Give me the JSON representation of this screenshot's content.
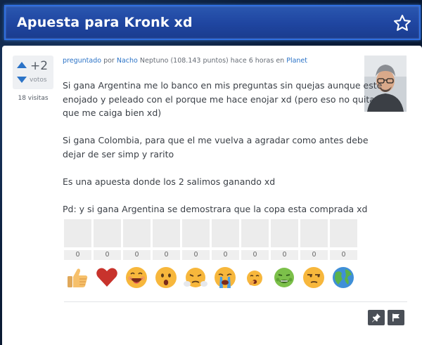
{
  "question": {
    "title": "Apuesta para Kronk xd",
    "votes": {
      "count": "+2",
      "label": "votos"
    },
    "views": "18 visitas",
    "meta": {
      "action": "preguntado",
      "by": "por",
      "user": "Nacho",
      "rank": "Neptuno (108.143 puntos)",
      "time": "hace 6 horas",
      "in": "en",
      "category": "Planet"
    },
    "body": [
      "Si gana Argentina me lo banco en mis preguntas sin quejas aunque este enojado y peleado con el porque me hace enojar xd (pero eso no quita que me caiga bien xd)",
      "Si gana Colombia, para que el me vuelva a agradar como antes debe dejar de ser simp y rarito",
      "Es una apuesta donde los 2 salimos ganando xd",
      "Pd: y si gana Argentina se demostrara que la copa esta comprada xd"
    ]
  },
  "reactions": [
    {
      "icon": "thumbs-up-icon",
      "count": "0",
      "level": 0
    },
    {
      "icon": "heart-icon",
      "count": "0",
      "level": 0
    },
    {
      "icon": "laughing-face-icon",
      "count": "0",
      "level": 0
    },
    {
      "icon": "surprised-face-icon",
      "count": "0",
      "level": 0
    },
    {
      "icon": "steaming-face-icon",
      "count": "0",
      "level": 0
    },
    {
      "icon": "crying-face-icon",
      "count": "0",
      "level": 0
    },
    {
      "icon": "yawning-face-icon",
      "count": "0",
      "level": 0
    },
    {
      "icon": "nauseated-face-icon",
      "count": "0",
      "level": 0
    },
    {
      "icon": "unamused-face-icon",
      "count": "0",
      "level": 0
    },
    {
      "icon": "globe-icon",
      "count": "0",
      "level": 0
    }
  ],
  "colors": {
    "accent": "#2b73c7",
    "title_bar": "#1f45a0",
    "action_button": "#4a4f57"
  },
  "actions": [
    {
      "icon": "pin-icon"
    },
    {
      "icon": "flag-icon"
    }
  ]
}
